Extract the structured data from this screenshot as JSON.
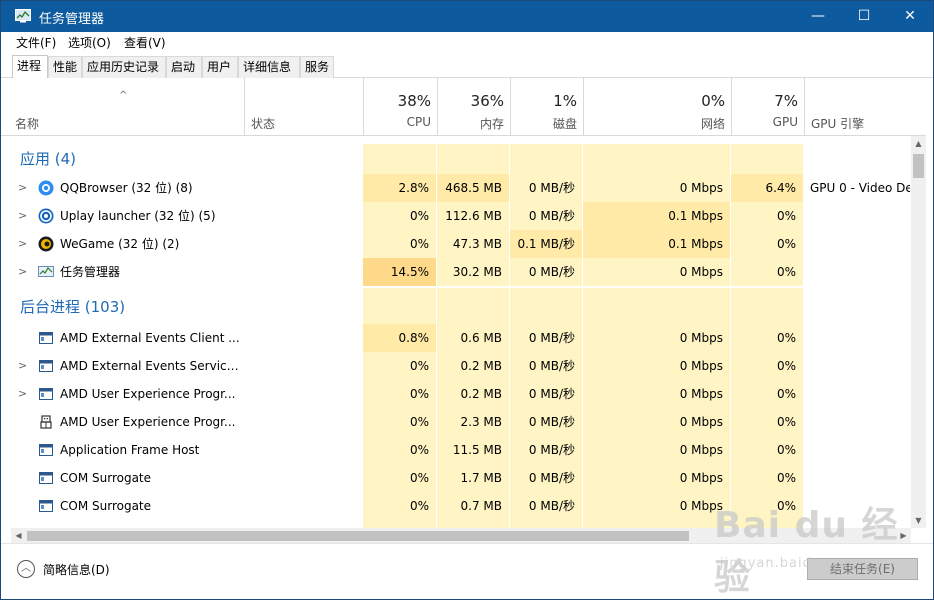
{
  "window": {
    "title": "任务管理器",
    "controls": {
      "minimize": "—",
      "maximize": "☐",
      "close": "✕"
    }
  },
  "menu": [
    {
      "label": "文件(F)"
    },
    {
      "label": "选项(O)"
    },
    {
      "label": "查看(V)"
    }
  ],
  "tabs": [
    {
      "label": "进程",
      "active": true
    },
    {
      "label": "性能"
    },
    {
      "label": "应用历史记录"
    },
    {
      "label": "启动"
    },
    {
      "label": "用户"
    },
    {
      "label": "详细信息"
    },
    {
      "label": "服务"
    }
  ],
  "columns": {
    "name": "名称",
    "status": "状态",
    "cpu": {
      "pct": "38%",
      "label": "CPU"
    },
    "memory": {
      "pct": "36%",
      "label": "内存"
    },
    "disk": {
      "pct": "1%",
      "label": "磁盘"
    },
    "network": {
      "pct": "0%",
      "label": "网络"
    },
    "gpu": {
      "pct": "7%",
      "label": "GPU"
    },
    "gpu_engine": "GPU 引擎",
    "sort_arrow": "^"
  },
  "groups": {
    "apps": "应用 (4)",
    "background": "后台进程 (103)"
  },
  "apps": [
    {
      "name": "QQBrowser (32 位) (8)",
      "cpu": "2.8%",
      "mem": "468.5 MB",
      "disk": "0 MB/秒",
      "net": "0 Mbps",
      "gpu": "6.4%",
      "engine": "GPU 0 - Video De"
    },
    {
      "name": "Uplay launcher (32 位) (5)",
      "cpu": "0%",
      "mem": "112.6 MB",
      "disk": "0 MB/秒",
      "net": "0.1 Mbps",
      "gpu": "0%",
      "engine": ""
    },
    {
      "name": "WeGame (32 位) (2)",
      "cpu": "0%",
      "mem": "47.3 MB",
      "disk": "0.1 MB/秒",
      "net": "0.1 Mbps",
      "gpu": "0%",
      "engine": ""
    },
    {
      "name": "任务管理器",
      "cpu": "14.5%",
      "mem": "30.2 MB",
      "disk": "0 MB/秒",
      "net": "0 Mbps",
      "gpu": "0%",
      "engine": ""
    }
  ],
  "background": [
    {
      "name": "AMD External Events Client ...",
      "cpu": "0.8%",
      "mem": "0.6 MB",
      "disk": "0 MB/秒",
      "net": "0 Mbps",
      "gpu": "0%"
    },
    {
      "name": "AMD External Events Service ...",
      "cpu": "0%",
      "mem": "0.2 MB",
      "disk": "0 MB/秒",
      "net": "0 Mbps",
      "gpu": "0%"
    },
    {
      "name": "AMD User Experience Progr...",
      "cpu": "0%",
      "mem": "0.2 MB",
      "disk": "0 MB/秒",
      "net": "0 Mbps",
      "gpu": "0%"
    },
    {
      "name": "AMD User Experience Progr...",
      "cpu": "0%",
      "mem": "2.3 MB",
      "disk": "0 MB/秒",
      "net": "0 Mbps",
      "gpu": "0%"
    },
    {
      "name": "Application Frame Host",
      "cpu": "0%",
      "mem": "11.5 MB",
      "disk": "0 MB/秒",
      "net": "0 Mbps",
      "gpu": "0%"
    },
    {
      "name": "COM Surrogate",
      "cpu": "0%",
      "mem": "1.7 MB",
      "disk": "0 MB/秒",
      "net": "0 Mbps",
      "gpu": "0%"
    },
    {
      "name": "COM Surrogate",
      "cpu": "0%",
      "mem": "0.7 MB",
      "disk": "0 MB/秒",
      "net": "0 Mbps",
      "gpu": "0%"
    }
  ],
  "footer": {
    "fewer_details": "简略信息(D)",
    "end_task": "结束任务(E)"
  },
  "watermark": {
    "brand": "Bai du 经验",
    "url": "jingyan.baidu.com"
  },
  "colors": {
    "titlebar": "#0d5a9e",
    "group_title": "#1e6ab5",
    "heat_light": "#fff4c4",
    "heat_mid": "#ffeaa8",
    "heat_strong": "#ffd98a"
  }
}
